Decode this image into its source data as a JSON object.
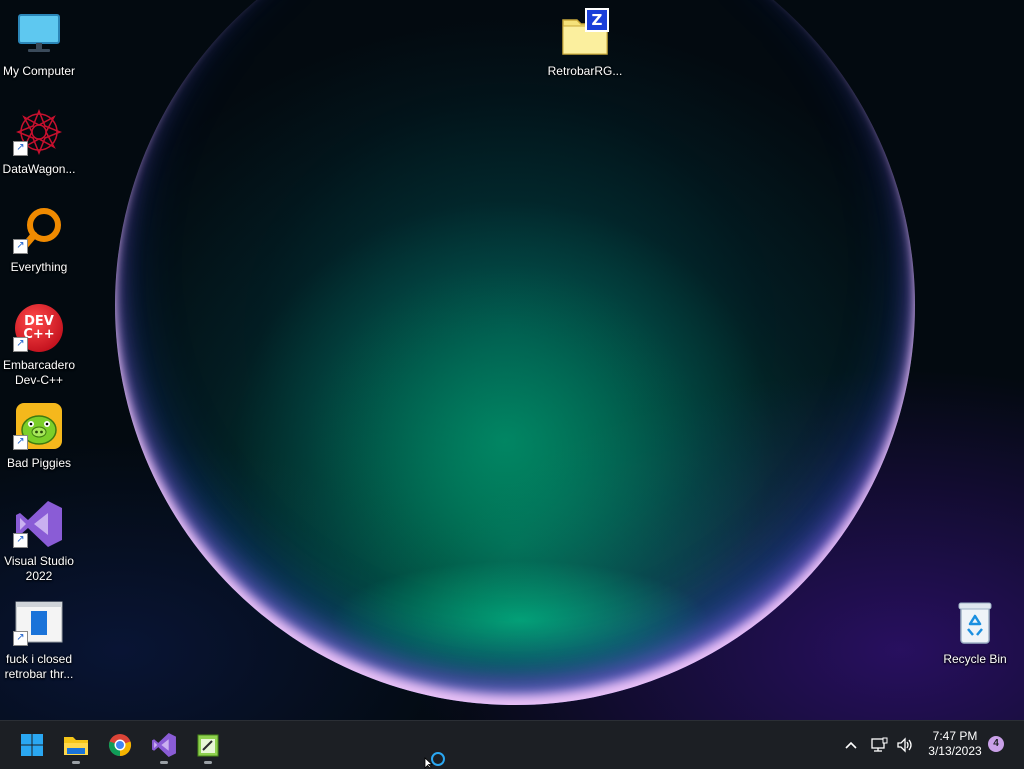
{
  "desktop": {
    "icons": [
      {
        "label": "My Computer",
        "icon": "monitor-icon"
      },
      {
        "label": "DataWagon...",
        "icon": "starburst-icon"
      },
      {
        "label": "Everything",
        "icon": "magnifier-icon"
      },
      {
        "label": "Embarcadero Dev-C++",
        "icon": "devcpp-icon"
      },
      {
        "label": "Bad Piggies",
        "icon": "pig-icon"
      },
      {
        "label": "Visual Studio 2022",
        "icon": "visual-studio-icon"
      },
      {
        "label": "fuck i closed retrobar thr...",
        "icon": "document-icon"
      },
      {
        "label": "RetrobarRG...",
        "icon": "zip-folder-icon"
      },
      {
        "label": "Recycle Bin",
        "icon": "recycle-bin-icon"
      }
    ],
    "devcpp_text": "DEV C++",
    "zip_letter": "Z"
  },
  "taskbar": {
    "pinned": [
      {
        "name": "start-button",
        "icon": "windows-logo-icon"
      },
      {
        "name": "file-explorer-button",
        "icon": "folder-icon"
      },
      {
        "name": "chrome-button",
        "icon": "chrome-icon"
      },
      {
        "name": "visual-studio-button",
        "icon": "visual-studio-icon"
      },
      {
        "name": "notepad-button",
        "icon": "notepad-icon"
      }
    ],
    "clock": {
      "time": "7:47 PM",
      "date": "3/13/2023"
    },
    "notifications_count": "4",
    "tray_icons": [
      "chevron-up-icon",
      "network-icon",
      "volume-icon"
    ]
  },
  "colors": {
    "taskbar_bg": "#1c1f24",
    "accent_vs": "#8a5cd6",
    "accent_badge": "#c9a0e8"
  }
}
